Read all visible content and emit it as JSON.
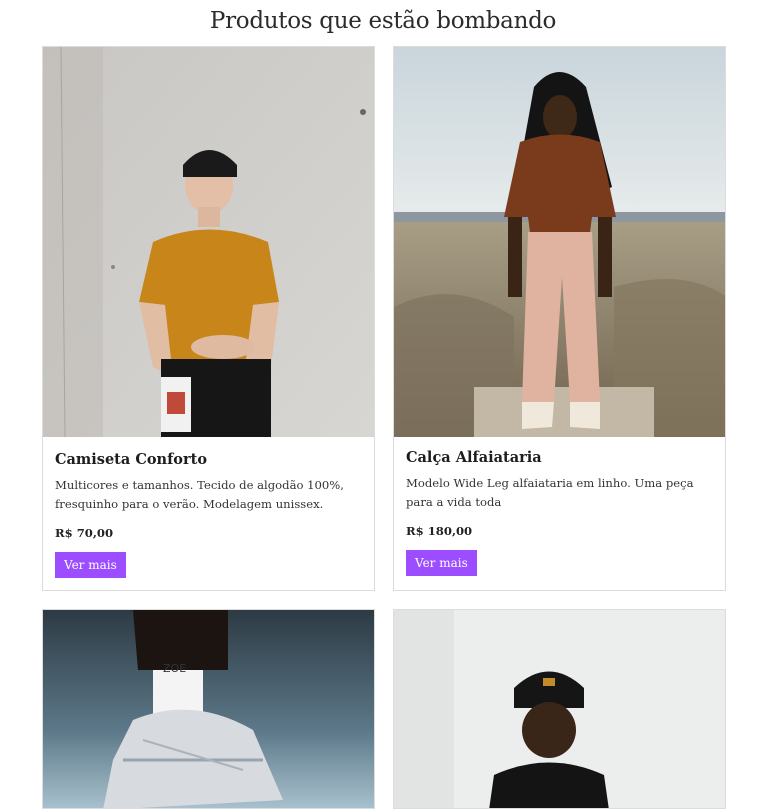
{
  "page": {
    "title": "Produtos que estão bombando"
  },
  "products": [
    {
      "name": "Camiseta Conforto",
      "description": "Multicores e tamanhos. Tecido de algodão 100%, fresquinho para o verão. Modelagem unissex.",
      "price": "R$ 70,00",
      "button": "Ver mais"
    },
    {
      "name": "Calça Alfaiataria",
      "description": "Modelo Wide Leg alfaiataria em linho. Uma peça para a vida toda",
      "price": "R$ 180,00",
      "button": "Ver mais"
    }
  ],
  "colors": {
    "accent": "#9b4dff",
    "border": "#dcdcdc"
  }
}
